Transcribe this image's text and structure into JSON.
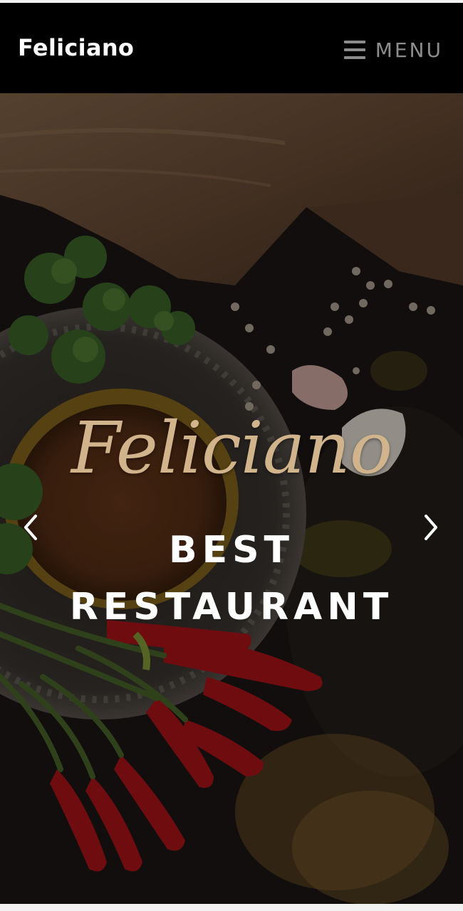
{
  "navbar": {
    "brand": "Feliciano",
    "menu_label": "MENU"
  },
  "hero": {
    "script_title": "Feliciano",
    "headline_line1": "BEST",
    "headline_line2": "RESTAURANT",
    "prev_icon": "chevron-left-icon",
    "next_icon": "chevron-right-icon"
  },
  "colors": {
    "navbar_bg": "#000000",
    "script_title": "#d2b48c",
    "headline": "#ffffff"
  }
}
